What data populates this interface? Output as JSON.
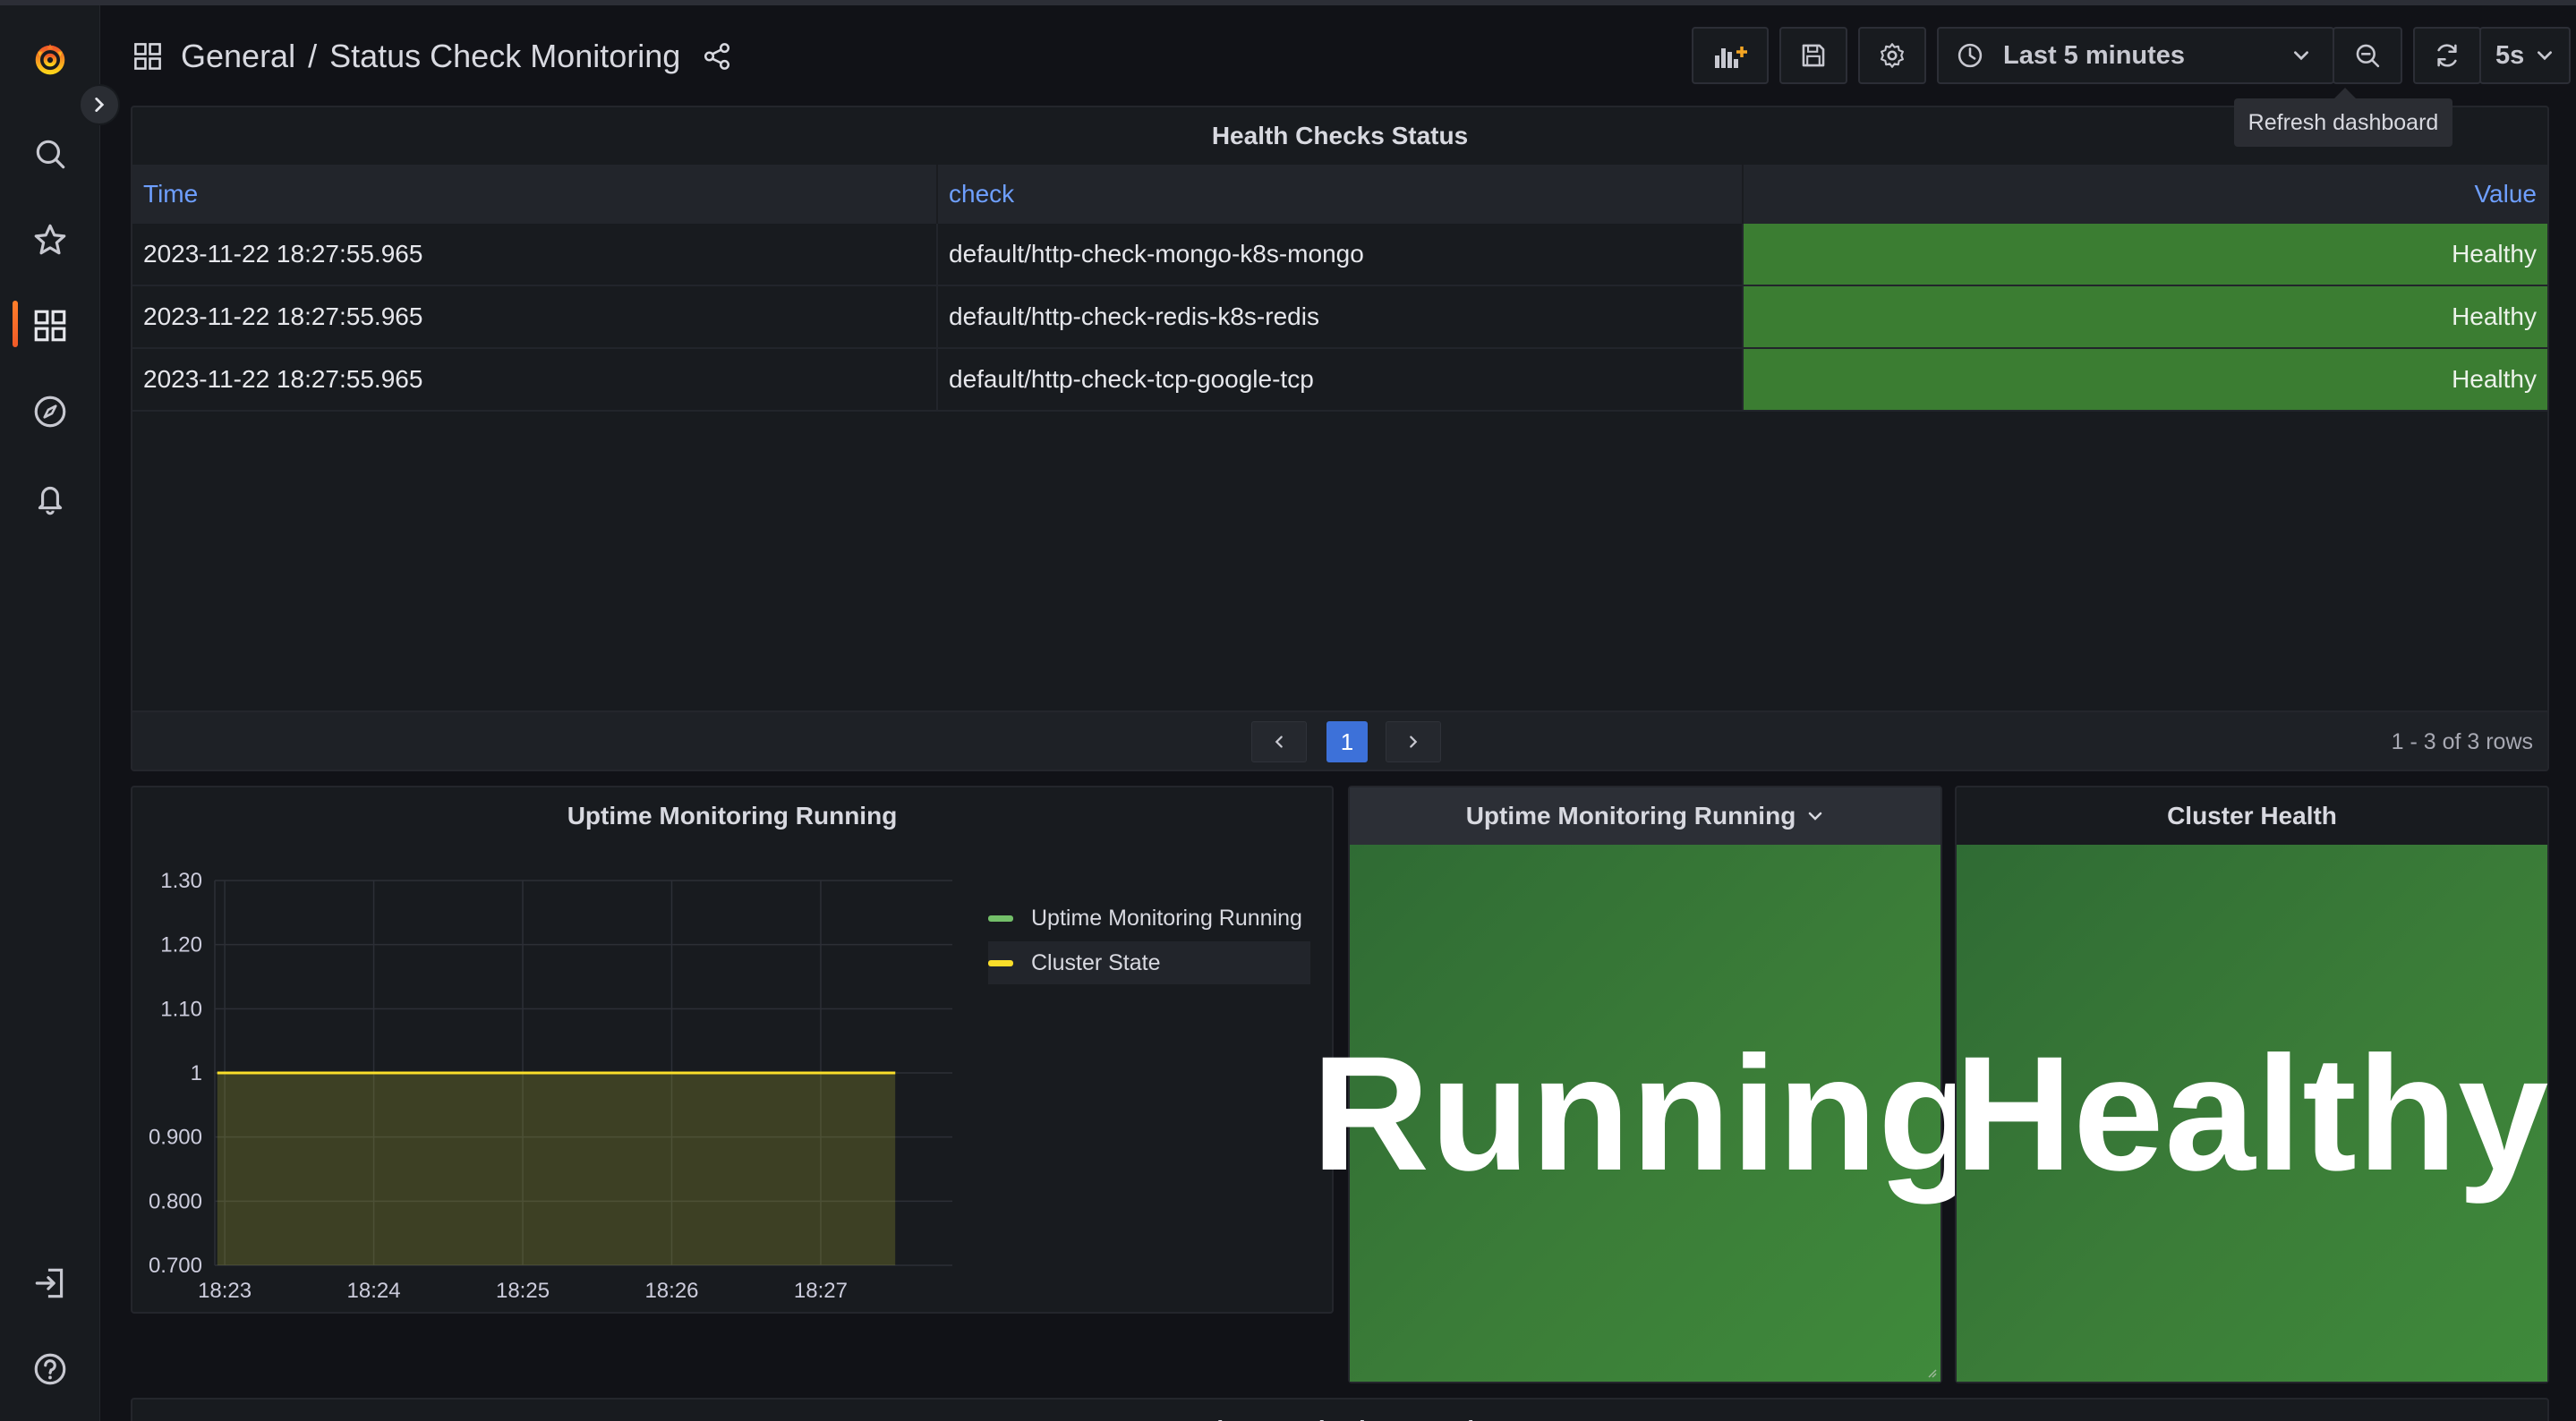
{
  "breadcrumb": {
    "folder": "General",
    "separator": "/",
    "dashboard": "Status Check Monitoring"
  },
  "toolbar": {
    "time_range": "Last 5 minutes",
    "refresh_interval": "5s",
    "tooltip": "Refresh dashboard"
  },
  "table_panel": {
    "title": "Health Checks Status",
    "columns": [
      "Time",
      "check",
      "Value"
    ],
    "rows": [
      {
        "time": "2023-11-22 18:27:55.965",
        "check": "default/http-check-mongo-k8s-mongo",
        "value": "Healthy"
      },
      {
        "time": "2023-11-22 18:27:55.965",
        "check": "default/http-check-redis-k8s-redis",
        "value": "Healthy"
      },
      {
        "time": "2023-11-22 18:27:55.965",
        "check": "default/http-check-tcp-google-tcp",
        "value": "Healthy"
      }
    ],
    "current_page": "1",
    "row_count": "1 - 3 of 3 rows"
  },
  "chart_panel": {
    "title": "Uptime Monitoring Running"
  },
  "chart_data": {
    "type": "area",
    "title": "Uptime Monitoring Running",
    "x": [
      "18:22:57",
      "18:27:30"
    ],
    "x_ticks": [
      "18:23",
      "18:24",
      "18:25",
      "18:26",
      "18:27"
    ],
    "y_ticks": [
      "0.700",
      "0.800",
      "0.900",
      "1",
      "1.10",
      "1.20",
      "1.30"
    ],
    "ylim": [
      0.7,
      1.3
    ],
    "series": [
      {
        "name": "Uptime Monitoring Running",
        "values": [
          1,
          1
        ],
        "color": "#73bf69"
      },
      {
        "name": "Cluster State",
        "values": [
          1,
          1
        ],
        "color": "#fade2a"
      }
    ],
    "legend_position": "right",
    "grid": true
  },
  "stat_uptime": {
    "title": "Uptime Monitoring Running",
    "value": "Running"
  },
  "stat_cluster": {
    "title": "Cluster Health",
    "value": "Healthy"
  },
  "bottom_panel": {
    "title": "Uptime Monitoring Running"
  },
  "colors": {
    "healthy": "#3b7d32",
    "accent": "#6e9fff",
    "brand": "#f05a28",
    "legend_hover": "#22252b"
  }
}
